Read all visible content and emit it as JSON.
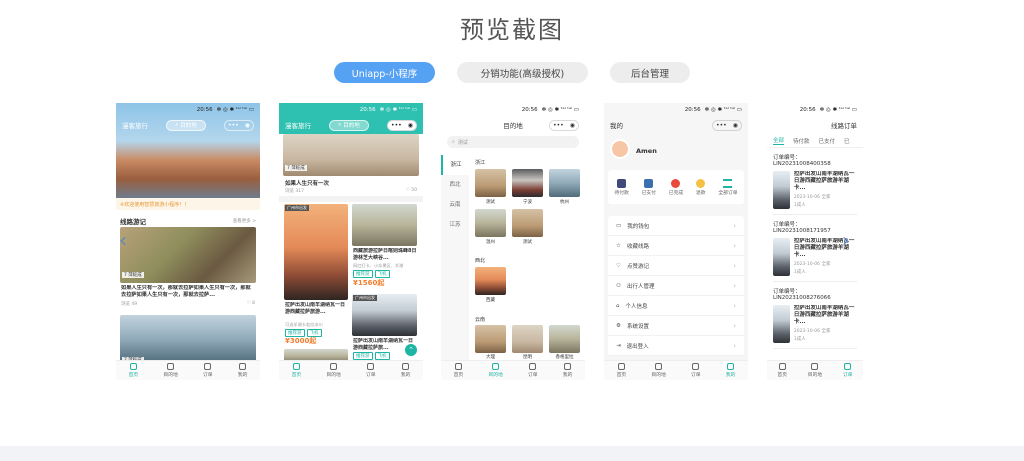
{
  "page_title": "预览截图",
  "tabs": [
    {
      "label": "Uniapp-小程序",
      "active": true
    },
    {
      "label": "分销功能(高级授权)",
      "active": false
    },
    {
      "label": "后台管理",
      "active": false
    }
  ],
  "colors": {
    "accent": "#55a1f3",
    "teal": "#1fb5a4",
    "price": "#ef7e2f"
  },
  "status_time": "20:56",
  "status_icons": "✻ ◎ ✱ ᵗᵃˡ ᵗᵃˡ ▭",
  "tabbar": {
    "home": "首页",
    "dest": "目的地",
    "order": "订单",
    "mine": "我的"
  },
  "phone1": {
    "nav_title": "漫客旅行",
    "search_label": "目的地",
    "notice": "※欢迎使用智慧旅游小程序！！",
    "section_title": "线路游记",
    "more": "查看更多 >",
    "card1_badge": "7 萍蛇成",
    "card1_text": "如果人生只有一次，那就去拉萨如果人生只有一次，那就去拉萨如果人生只有一次，那就去拉萨...",
    "card1_meta_left": "浏览 49",
    "card1_meta_right": "♡ 8",
    "card2_badge": "7 萍蛇成"
  },
  "phone2": {
    "nav_title": "漫客旅行",
    "search_label": "目的地",
    "badge": "7 萍蛇成",
    "note_title": "如果人生只有一次",
    "note_meta_left": "浏览 317",
    "note_meta_right": "♡ 50",
    "left_badge": "广州市出发",
    "left_title": "拉萨出发山南羊湖纳瓦一日游西藏拉萨旅游...",
    "left_sub": "可选羊湖卡若拉冰川",
    "left_tags": [
      "推荐游",
      "飞机"
    ],
    "left_price": "¥3000起",
    "right1_title": "西藏旅游拉萨日喀则珠峰8日游林芝大峡谷...",
    "right1_sub": "网红打卡、小众景区、羊湖",
    "right1_tags": [
      "推荐游",
      "飞机"
    ],
    "right1_price": "¥1560起",
    "right2_badge": "广州市出发",
    "right2_title": "拉萨出发山南羊湖纳瓦一日游西藏拉萨旅...",
    "right2_tags": [
      "推荐游",
      "飞机"
    ]
  },
  "phone3": {
    "nav_title": "目的地",
    "search_placeholder": "测试",
    "sidebar": [
      "浙江",
      "西北",
      "云南",
      "江苏"
    ],
    "group1": "浙江",
    "group1_items": [
      "测试",
      "宁波",
      "杭州",
      "温州",
      "测试"
    ],
    "group2": "西北",
    "group2_items": [
      "西藏"
    ],
    "group3": "云南",
    "group3_items": [
      "大理",
      "昆明",
      "香格里拉"
    ]
  },
  "phone4": {
    "nav_title": "我的",
    "user_name": "Amen",
    "order_icons": [
      "待付款",
      "已支付",
      "已完成",
      "退款",
      "全部订单"
    ],
    "menu": [
      "我的钱包",
      "收藏线路",
      "点赞游记",
      "出行人管理",
      "个人信息",
      "系统设置",
      "退出登入"
    ]
  },
  "phone5": {
    "nav_title": "线路订单",
    "order_tabs": [
      "全部",
      "待付款",
      "已支付",
      "已"
    ],
    "orders": [
      {
        "no": "订单编号：LIN20231008400358",
        "title": "拉萨出发山南羊湖纳瓦一日游西藏拉萨旅游羊湖卡...",
        "date": "2023-10-06 全家",
        "people": "1成人"
      },
      {
        "no": "订单编号：LIN20231008171957",
        "title": "拉萨出发山南羊湖纳瓦一日游西藏拉萨旅游羊湖卡...",
        "date": "2023-10-06 全家",
        "people": "1成人"
      },
      {
        "no": "订单编号：LIN20231008276066",
        "title": "拉萨出发山南羊湖纳瓦一日游西藏拉萨旅游羊湖卡...",
        "date": "2023-10-06 全家",
        "people": "1成人"
      }
    ]
  }
}
